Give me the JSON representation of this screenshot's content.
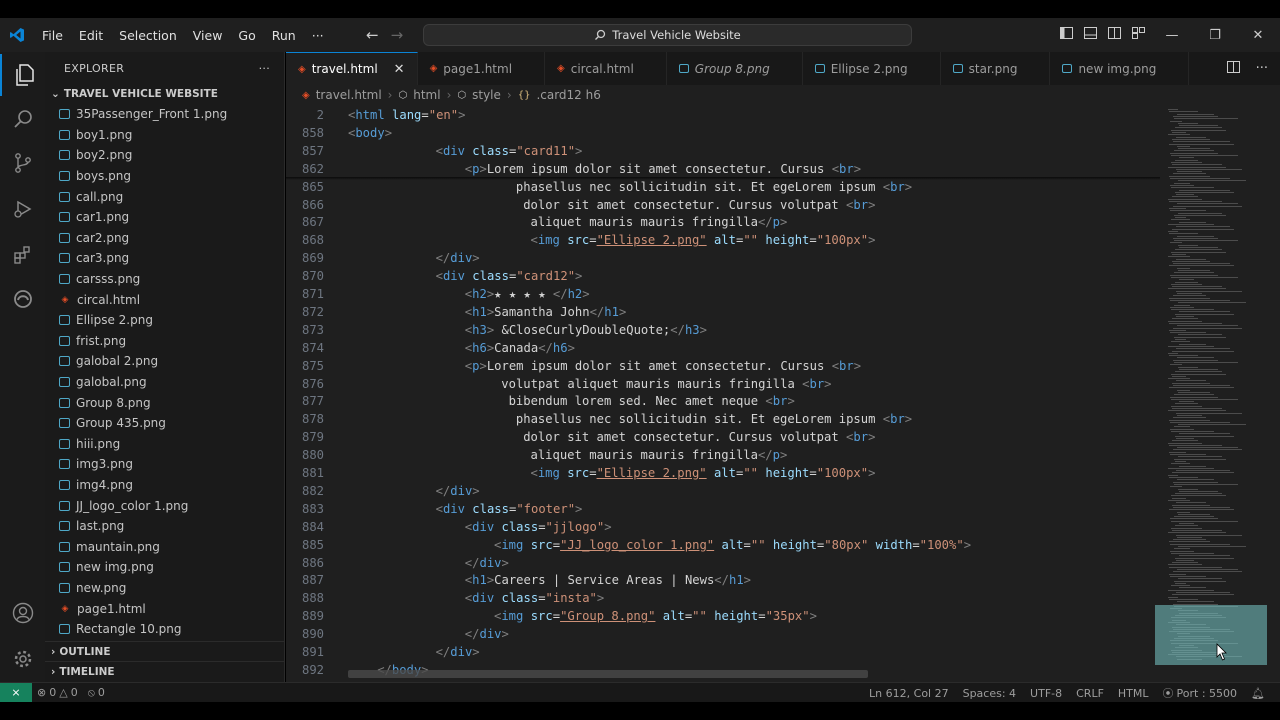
{
  "titlebar": {
    "menu": [
      "File",
      "Edit",
      "Selection",
      "View",
      "Go",
      "Run",
      "···"
    ],
    "search_text": "Travel Vehicle Website"
  },
  "sidebar": {
    "header": "EXPLORER",
    "more": "···",
    "folder": "TRAVEL VEHICLE WEBSITE",
    "files": [
      {
        "name": "35Passenger_Front 1.png",
        "type": "img"
      },
      {
        "name": "boy1.png",
        "type": "img"
      },
      {
        "name": "boy2.png",
        "type": "img"
      },
      {
        "name": "boys.png",
        "type": "img"
      },
      {
        "name": "call.png",
        "type": "img"
      },
      {
        "name": "car1.png",
        "type": "img"
      },
      {
        "name": "car2.png",
        "type": "img"
      },
      {
        "name": "car3.png",
        "type": "img"
      },
      {
        "name": "carsss.png",
        "type": "img"
      },
      {
        "name": "circal.html",
        "type": "html"
      },
      {
        "name": "Ellipse 2.png",
        "type": "img"
      },
      {
        "name": "frist.png",
        "type": "img"
      },
      {
        "name": "galobal 2.png",
        "type": "img"
      },
      {
        "name": "galobal.png",
        "type": "img"
      },
      {
        "name": "Group 8.png",
        "type": "img"
      },
      {
        "name": "Group 435.png",
        "type": "img"
      },
      {
        "name": "hiii.png",
        "type": "img"
      },
      {
        "name": "img3.png",
        "type": "img"
      },
      {
        "name": "img4.png",
        "type": "img"
      },
      {
        "name": "JJ_logo_color 1.png",
        "type": "img"
      },
      {
        "name": "last.png",
        "type": "img"
      },
      {
        "name": "mauntain.png",
        "type": "img"
      },
      {
        "name": "new img.png",
        "type": "img"
      },
      {
        "name": "new.png",
        "type": "img"
      },
      {
        "name": "page1.html",
        "type": "html"
      },
      {
        "name": "Rectangle 10.png",
        "type": "img"
      }
    ],
    "outline": "OUTLINE",
    "timeline": "TIMELINE"
  },
  "tabs": [
    {
      "label": "travel.html",
      "type": "html",
      "active": true,
      "italic": false
    },
    {
      "label": "page1.html",
      "type": "html",
      "active": false,
      "italic": false
    },
    {
      "label": "circal.html",
      "type": "html",
      "active": false,
      "italic": false
    },
    {
      "label": "Group 8.png",
      "type": "img",
      "active": false,
      "italic": true
    },
    {
      "label": "Ellipse 2.png",
      "type": "img",
      "active": false,
      "italic": false
    },
    {
      "label": "star.png",
      "type": "img",
      "active": false,
      "italic": false
    },
    {
      "label": "new img.png",
      "type": "img",
      "active": false,
      "italic": false
    }
  ],
  "breadcrumb": [
    "travel.html",
    "html",
    "style",
    ".card12 h6"
  ],
  "editor": {
    "lines": [
      {
        "n": "2",
        "indent": 0,
        "tokens": [
          [
            "p",
            "<"
          ],
          [
            "t",
            "html"
          ],
          [
            "x",
            " "
          ],
          [
            "a",
            "lang"
          ],
          [
            "x",
            "="
          ],
          [
            "s",
            "\"en\""
          ],
          [
            "p",
            ">"
          ]
        ]
      },
      {
        "n": "858",
        "indent": 0,
        "tokens": [
          [
            "p",
            "<"
          ],
          [
            "t",
            "body"
          ],
          [
            "p",
            ">"
          ]
        ]
      },
      {
        "n": "857",
        "indent": 12,
        "tokens": [
          [
            "p",
            "<"
          ],
          [
            "t",
            "div"
          ],
          [
            "x",
            " "
          ],
          [
            "a",
            "class"
          ],
          [
            "x",
            "="
          ],
          [
            "s",
            "\"card11\""
          ],
          [
            "p",
            ">"
          ]
        ]
      },
      {
        "n": "862",
        "indent": 16,
        "tokens": [
          [
            "p",
            "<"
          ],
          [
            "t",
            "p"
          ],
          [
            "p",
            ">"
          ],
          [
            "x",
            "Lorem ipsum dolor sit amet consectetur. Cursus "
          ],
          [
            "p",
            "<"
          ],
          [
            "t",
            "br"
          ],
          [
            "p",
            ">"
          ]
        ]
      },
      {
        "n": "865",
        "indent": 23,
        "tokens": [
          [
            "x",
            "phasellus nec sollicitudin sit. Et egeLorem ipsum "
          ],
          [
            "p",
            "<"
          ],
          [
            "t",
            "br"
          ],
          [
            "p",
            ">"
          ]
        ]
      },
      {
        "n": "866",
        "indent": 24,
        "tokens": [
          [
            "x",
            "dolor sit amet consectetur. Cursus volutpat "
          ],
          [
            "p",
            "<"
          ],
          [
            "t",
            "br"
          ],
          [
            "p",
            ">"
          ]
        ]
      },
      {
        "n": "867",
        "indent": 25,
        "tokens": [
          [
            "x",
            "aliquet mauris mauris fringilla"
          ],
          [
            "p",
            "</"
          ],
          [
            "t",
            "p"
          ],
          [
            "p",
            ">"
          ]
        ]
      },
      {
        "n": "868",
        "indent": 25,
        "tokens": [
          [
            "p",
            "<"
          ],
          [
            "t",
            "img"
          ],
          [
            "x",
            " "
          ],
          [
            "a",
            "src"
          ],
          [
            "x",
            "="
          ],
          [
            "su",
            "\"Ellipse 2.png\""
          ],
          [
            "x",
            " "
          ],
          [
            "a",
            "alt"
          ],
          [
            "x",
            "="
          ],
          [
            "s",
            "\"\""
          ],
          [
            "x",
            " "
          ],
          [
            "a",
            "height"
          ],
          [
            "x",
            "="
          ],
          [
            "s",
            "\"100px\""
          ],
          [
            "p",
            ">"
          ]
        ]
      },
      {
        "n": "869",
        "indent": 12,
        "tokens": [
          [
            "p",
            "</"
          ],
          [
            "t",
            "div"
          ],
          [
            "p",
            ">"
          ]
        ]
      },
      {
        "n": "870",
        "indent": 12,
        "tokens": [
          [
            "p",
            "<"
          ],
          [
            "t",
            "div"
          ],
          [
            "x",
            " "
          ],
          [
            "a",
            "class"
          ],
          [
            "x",
            "="
          ],
          [
            "s",
            "\"card12\""
          ],
          [
            "p",
            ">"
          ]
        ]
      },
      {
        "n": "871",
        "indent": 16,
        "tokens": [
          [
            "p",
            "<"
          ],
          [
            "t",
            "h2"
          ],
          [
            "p",
            ">"
          ],
          [
            "x",
            "★ ★ ★ ★ "
          ],
          [
            "p",
            "</"
          ],
          [
            "t",
            "h2"
          ],
          [
            "p",
            ">"
          ]
        ]
      },
      {
        "n": "872",
        "indent": 16,
        "tokens": [
          [
            "p",
            "<"
          ],
          [
            "t",
            "h1"
          ],
          [
            "p",
            ">"
          ],
          [
            "x",
            "Samantha John"
          ],
          [
            "p",
            "</"
          ],
          [
            "t",
            "h1"
          ],
          [
            "p",
            ">"
          ]
        ]
      },
      {
        "n": "873",
        "indent": 16,
        "tokens": [
          [
            "p",
            "<"
          ],
          [
            "t",
            "h3"
          ],
          [
            "p",
            ">"
          ],
          [
            "x",
            " &CloseCurlyDoubleQuote;"
          ],
          [
            "p",
            "</"
          ],
          [
            "t",
            "h3"
          ],
          [
            "p",
            ">"
          ]
        ]
      },
      {
        "n": "874",
        "indent": 16,
        "tokens": [
          [
            "p",
            "<"
          ],
          [
            "t",
            "h6"
          ],
          [
            "p",
            ">"
          ],
          [
            "x",
            "Canada"
          ],
          [
            "p",
            "</"
          ],
          [
            "t",
            "h6"
          ],
          [
            "p",
            ">"
          ]
        ]
      },
      {
        "n": "875",
        "indent": 16,
        "tokens": [
          [
            "p",
            "<"
          ],
          [
            "t",
            "p"
          ],
          [
            "p",
            ">"
          ],
          [
            "x",
            "Lorem ipsum dolor sit amet consectetur. Cursus "
          ],
          [
            "p",
            "<"
          ],
          [
            "t",
            "br"
          ],
          [
            "p",
            ">"
          ]
        ]
      },
      {
        "n": "876",
        "indent": 21,
        "tokens": [
          [
            "x",
            "volutpat aliquet mauris mauris fringilla "
          ],
          [
            "p",
            "<"
          ],
          [
            "t",
            "br"
          ],
          [
            "p",
            ">"
          ]
        ]
      },
      {
        "n": "877",
        "indent": 22,
        "tokens": [
          [
            "x",
            "bibendum lorem sed. Nec amet neque "
          ],
          [
            "p",
            "<"
          ],
          [
            "t",
            "br"
          ],
          [
            "p",
            ">"
          ]
        ]
      },
      {
        "n": "878",
        "indent": 23,
        "tokens": [
          [
            "x",
            "phasellus nec sollicitudin sit. Et egeLorem ipsum "
          ],
          [
            "p",
            "<"
          ],
          [
            "t",
            "br"
          ],
          [
            "p",
            ">"
          ]
        ]
      },
      {
        "n": "879",
        "indent": 24,
        "tokens": [
          [
            "x",
            "dolor sit amet consectetur. Cursus volutpat "
          ],
          [
            "p",
            "<"
          ],
          [
            "t",
            "br"
          ],
          [
            "p",
            ">"
          ]
        ]
      },
      {
        "n": "880",
        "indent": 25,
        "tokens": [
          [
            "x",
            "aliquet mauris mauris fringilla"
          ],
          [
            "p",
            "</"
          ],
          [
            "t",
            "p"
          ],
          [
            "p",
            ">"
          ]
        ]
      },
      {
        "n": "881",
        "indent": 25,
        "tokens": [
          [
            "p",
            "<"
          ],
          [
            "t",
            "img"
          ],
          [
            "x",
            " "
          ],
          [
            "a",
            "src"
          ],
          [
            "x",
            "="
          ],
          [
            "su",
            "\"Ellipse 2.png\""
          ],
          [
            "x",
            " "
          ],
          [
            "a",
            "alt"
          ],
          [
            "x",
            "="
          ],
          [
            "s",
            "\"\""
          ],
          [
            "x",
            " "
          ],
          [
            "a",
            "height"
          ],
          [
            "x",
            "="
          ],
          [
            "s",
            "\"100px\""
          ],
          [
            "p",
            ">"
          ]
        ]
      },
      {
        "n": "882",
        "indent": 12,
        "tokens": [
          [
            "p",
            "</"
          ],
          [
            "t",
            "div"
          ],
          [
            "p",
            ">"
          ]
        ]
      },
      {
        "n": "883",
        "indent": 12,
        "tokens": [
          [
            "p",
            "<"
          ],
          [
            "t",
            "div"
          ],
          [
            "x",
            " "
          ],
          [
            "a",
            "class"
          ],
          [
            "x",
            "="
          ],
          [
            "s",
            "\"footer\""
          ],
          [
            "p",
            ">"
          ]
        ]
      },
      {
        "n": "884",
        "indent": 16,
        "tokens": [
          [
            "p",
            "<"
          ],
          [
            "t",
            "div"
          ],
          [
            "x",
            " "
          ],
          [
            "a",
            "class"
          ],
          [
            "x",
            "="
          ],
          [
            "s",
            "\"jjlogo\""
          ],
          [
            "p",
            ">"
          ]
        ]
      },
      {
        "n": "885",
        "indent": 20,
        "tokens": [
          [
            "p",
            "<"
          ],
          [
            "t",
            "img"
          ],
          [
            "x",
            " "
          ],
          [
            "a",
            "src"
          ],
          [
            "x",
            "="
          ],
          [
            "su",
            "\"JJ_logo_color 1.png\""
          ],
          [
            "x",
            " "
          ],
          [
            "a",
            "alt"
          ],
          [
            "x",
            "="
          ],
          [
            "s",
            "\"\""
          ],
          [
            "x",
            " "
          ],
          [
            "a",
            "height"
          ],
          [
            "x",
            "="
          ],
          [
            "s",
            "\"80px\""
          ],
          [
            "x",
            " "
          ],
          [
            "a",
            "width"
          ],
          [
            "x",
            "="
          ],
          [
            "s",
            "\"100%\""
          ],
          [
            "p",
            ">"
          ]
        ]
      },
      {
        "n": "886",
        "indent": 16,
        "tokens": [
          [
            "p",
            "</"
          ],
          [
            "t",
            "div"
          ],
          [
            "p",
            ">"
          ]
        ]
      },
      {
        "n": "887",
        "indent": 16,
        "tokens": [
          [
            "p",
            "<"
          ],
          [
            "t",
            "h1"
          ],
          [
            "p",
            ">"
          ],
          [
            "x",
            "Careers | Service Areas | News"
          ],
          [
            "p",
            "</"
          ],
          [
            "t",
            "h1"
          ],
          [
            "p",
            ">"
          ]
        ]
      },
      {
        "n": "888",
        "indent": 16,
        "tokens": [
          [
            "p",
            "<"
          ],
          [
            "t",
            "div"
          ],
          [
            "x",
            " "
          ],
          [
            "a",
            "class"
          ],
          [
            "x",
            "="
          ],
          [
            "s",
            "\"insta\""
          ],
          [
            "p",
            ">"
          ]
        ]
      },
      {
        "n": "889",
        "indent": 20,
        "tokens": [
          [
            "p",
            "<"
          ],
          [
            "t",
            "img"
          ],
          [
            "x",
            " "
          ],
          [
            "a",
            "src"
          ],
          [
            "x",
            "="
          ],
          [
            "su",
            "\"Group 8.png\""
          ],
          [
            "x",
            " "
          ],
          [
            "a",
            "alt"
          ],
          [
            "x",
            "="
          ],
          [
            "s",
            "\"\""
          ],
          [
            "x",
            " "
          ],
          [
            "a",
            "height"
          ],
          [
            "x",
            "="
          ],
          [
            "s",
            "\"35px\""
          ],
          [
            "p",
            ">"
          ]
        ]
      },
      {
        "n": "890",
        "indent": 16,
        "tokens": [
          [
            "p",
            "</"
          ],
          [
            "t",
            "div"
          ],
          [
            "p",
            ">"
          ]
        ]
      },
      {
        "n": "891",
        "indent": 12,
        "tokens": [
          [
            "p",
            "</"
          ],
          [
            "t",
            "div"
          ],
          [
            "p",
            ">"
          ]
        ]
      },
      {
        "n": "892",
        "indent": 4,
        "tokens": [
          [
            "p",
            "</"
          ],
          [
            "t",
            "body"
          ],
          [
            "p",
            ">"
          ]
        ]
      }
    ]
  },
  "statusbar": {
    "remote": "⨯",
    "errors": "0",
    "warnings": "0",
    "ports_forwarded": "0",
    "position": "Ln 612, Col 27",
    "spaces": "Spaces: 4",
    "encoding": "UTF-8",
    "eol": "CRLF",
    "language": "HTML",
    "port": "Port : 5500"
  },
  "colors": {
    "accent": "#0a84d6",
    "tag": "#569cd6",
    "attribute": "#9cdcfe",
    "string": "#ce9178",
    "remote_bg": "#16825d"
  }
}
